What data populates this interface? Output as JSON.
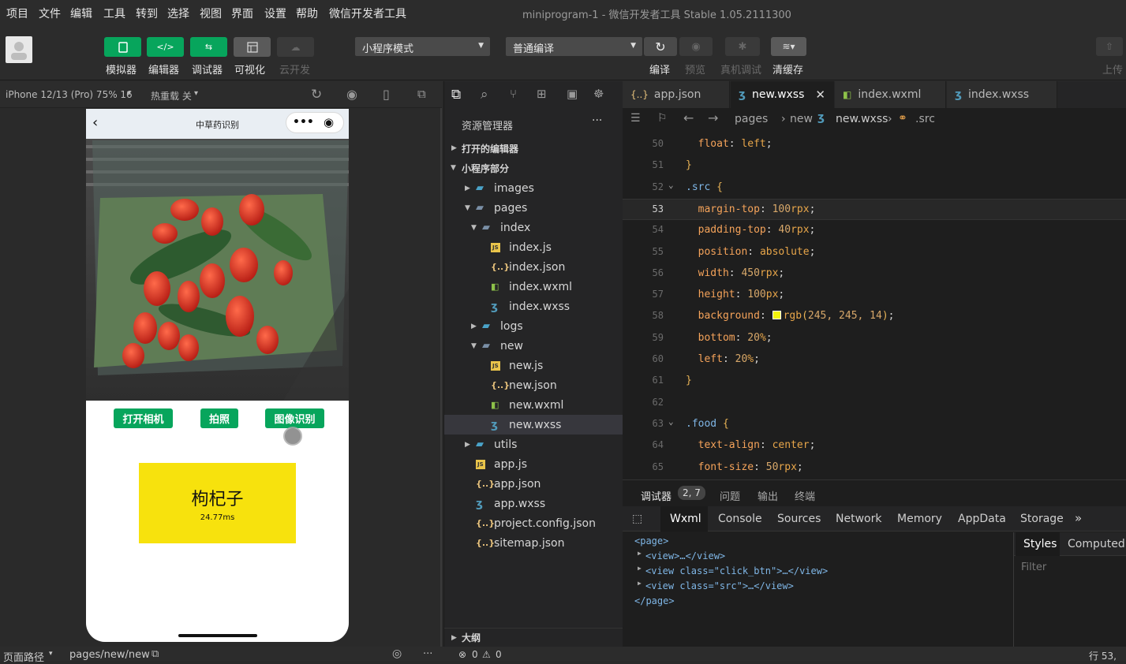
{
  "menu": [
    "项目",
    "文件",
    "编辑",
    "工具",
    "转到",
    "选择",
    "视图",
    "界面",
    "设置",
    "帮助",
    "微信开发者工具"
  ],
  "window_title": "miniprogram-1 - 微信开发者工具 Stable 1.05.2111300",
  "toolbar": {
    "simulator": "模拟器",
    "editor": "编辑器",
    "debugger": "调试器",
    "visual": "可视化",
    "cloud": "云开发",
    "mode_select": "小程序模式",
    "compile_select": "普通编译",
    "compile": "编译",
    "preview": "预览",
    "device_debug": "真机调试",
    "clear_cache": "清缓存",
    "upload": "上传"
  },
  "sim_header": {
    "device": "iPhone 12/13 (Pro) 75% 16",
    "hot_reload": "热重载 关"
  },
  "phone": {
    "nav_title": "中草药识别",
    "buttons": [
      "打开相机",
      "拍照",
      "图像识别"
    ],
    "result_name": "枸杞子",
    "result_time": "24.77ms"
  },
  "explorer": {
    "title": "资源管理器",
    "open_editors": "打开的编辑器",
    "section": "小程序部分",
    "tree": [
      {
        "label": "images",
        "type": "folder",
        "depth": 1
      },
      {
        "label": "pages",
        "type": "folder-open",
        "depth": 1
      },
      {
        "label": "index",
        "type": "folder-open",
        "depth": 2
      },
      {
        "label": "index.js",
        "type": "js",
        "depth": 3
      },
      {
        "label": "index.json",
        "type": "json",
        "depth": 3
      },
      {
        "label": "index.wxml",
        "type": "wxml",
        "depth": 3
      },
      {
        "label": "index.wxss",
        "type": "wxss",
        "depth": 3
      },
      {
        "label": "logs",
        "type": "folder",
        "depth": 2
      },
      {
        "label": "new",
        "type": "folder-open",
        "depth": 2
      },
      {
        "label": "new.js",
        "type": "js",
        "depth": 3
      },
      {
        "label": "new.json",
        "type": "json",
        "depth": 3
      },
      {
        "label": "new.wxml",
        "type": "wxml",
        "depth": 3
      },
      {
        "label": "new.wxss",
        "type": "wxss",
        "depth": 3,
        "selected": true
      },
      {
        "label": "utils",
        "type": "folder",
        "depth": 1
      },
      {
        "label": "app.js",
        "type": "js",
        "depth": 1
      },
      {
        "label": "app.json",
        "type": "json",
        "depth": 1
      },
      {
        "label": "app.wxss",
        "type": "wxss",
        "depth": 1
      },
      {
        "label": "project.config.json",
        "type": "json",
        "depth": 1
      },
      {
        "label": "sitemap.json",
        "type": "json",
        "depth": 1
      }
    ],
    "outline": "大纲"
  },
  "tabs": [
    "app.json",
    "new.wxss",
    "index.wxml",
    "index.wxss"
  ],
  "breadcrumb": [
    "pages",
    "new",
    "new.wxss",
    ".src"
  ],
  "code_lines": [
    {
      "n": "50",
      "text": "  float: left;"
    },
    {
      "n": "51",
      "text": "}"
    },
    {
      "n": "52",
      "text": ".src {"
    },
    {
      "n": "53",
      "text": "  margin-top: 100rpx;"
    },
    {
      "n": "54",
      "text": "  padding-top: 40rpx;"
    },
    {
      "n": "55",
      "text": "  position: absolute;"
    },
    {
      "n": "56",
      "text": "  width: 450rpx;"
    },
    {
      "n": "57",
      "text": "  height: 100px;"
    },
    {
      "n": "58",
      "text": "  background: rgb(245, 245, 14);"
    },
    {
      "n": "59",
      "text": "  bottom: 20%;"
    },
    {
      "n": "60",
      "text": "  left: 20%;"
    },
    {
      "n": "61",
      "text": "}"
    },
    {
      "n": "62",
      "text": ""
    },
    {
      "n": "63",
      "text": ".food {"
    },
    {
      "n": "64",
      "text": "  text-align: center;"
    },
    {
      "n": "65",
      "text": "  font-size: 50rpx;"
    }
  ],
  "swatch_color": "#f5f50e",
  "debug": {
    "tabs": [
      "调试器",
      "问题",
      "输出",
      "终端"
    ],
    "badge": "2, 7",
    "panel_tabs": [
      "Wxml",
      "Console",
      "Sources",
      "Network",
      "Memory",
      "AppData",
      "Storage"
    ],
    "side_tabs": [
      "Styles",
      "Computed"
    ],
    "filter": "Filter",
    "wxml": [
      "<page>",
      "<view>…</view>",
      "<view class=\"click_btn\">…</view>",
      "<view class=\"src\">…</view>",
      "</page>"
    ]
  },
  "status": {
    "path_label": "页面路径",
    "path": "pages/new/new",
    "errors": "0",
    "warnings": "0",
    "position": "行 53,"
  }
}
